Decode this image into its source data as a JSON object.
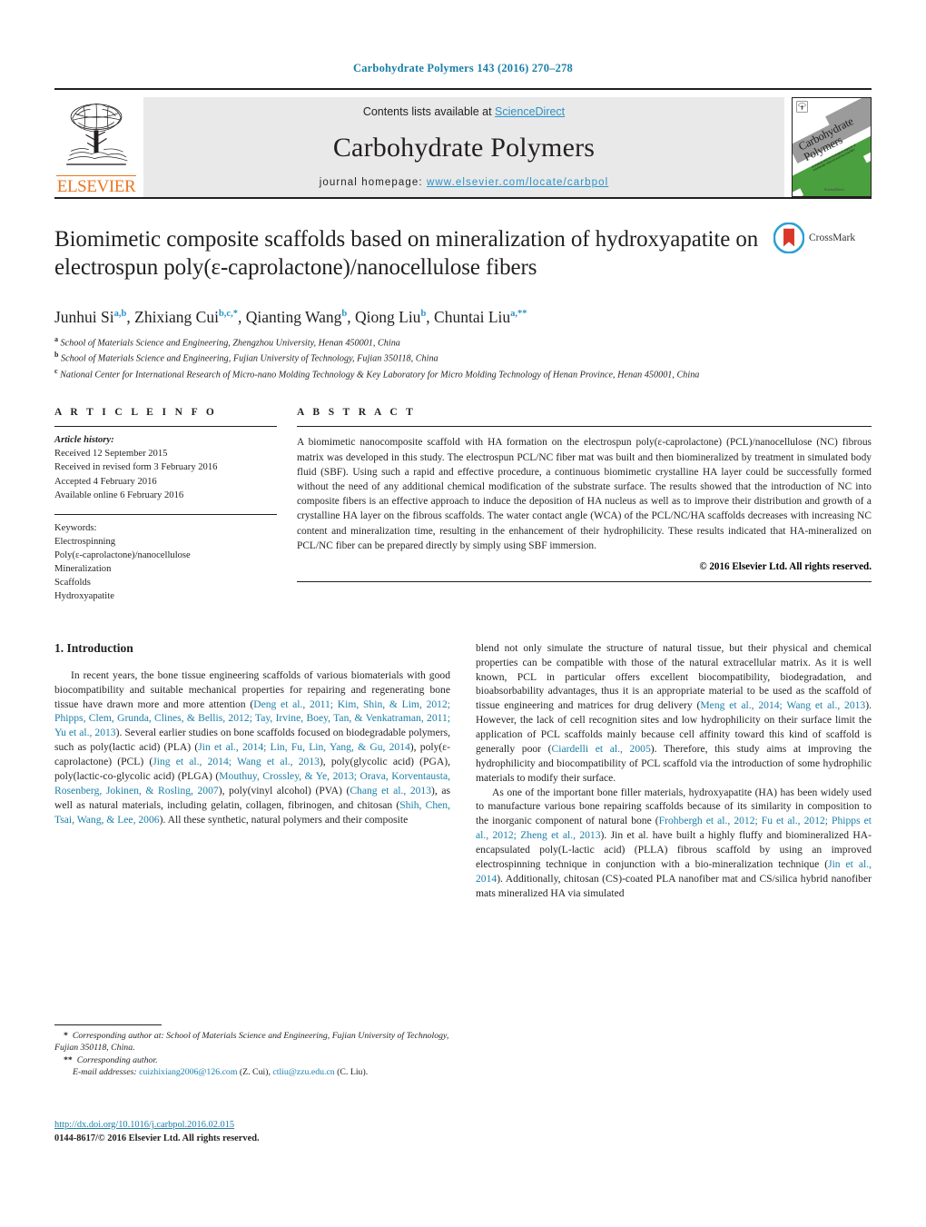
{
  "running_head": "Carbohydrate Polymers 143 (2016) 270–278",
  "masthead": {
    "contents_prefix": "Contents lists available at ",
    "sciencedirect": "ScienceDirect",
    "journal_name": "Carbohydrate Polymers",
    "homepage_prefix": "journal homepage: ",
    "homepage_url": "www.elsevier.com/locate/carbpol",
    "publisher": "ELSEVIER",
    "cover": {
      "title_line1": "Carbohydrate",
      "title_line2": "Polymers",
      "subtitle": "analytical and technological aspects of industrially-relevant polysaccharides",
      "footer": "ScienceDirect"
    }
  },
  "article": {
    "title": "Biomimetic composite scaffolds based on mineralization of hydroxyapatite on electrospun poly(ε-caprolactone)/nanocellulose fibers",
    "crossmark_label": "CrossMark",
    "authors": [
      {
        "name": "Junhui Si",
        "marks": "a,b",
        "sep": ", "
      },
      {
        "name": "Zhixiang Cui",
        "marks": "b,c,*",
        "sep": ", "
      },
      {
        "name": "Qianting Wang",
        "marks": "b",
        "sep": ", "
      },
      {
        "name": "Qiong Liu",
        "marks": "b",
        "sep": ", "
      },
      {
        "name": "Chuntai Liu",
        "marks": "a,**",
        "sep": ""
      }
    ],
    "affiliations": [
      {
        "mark": "a",
        "text": "School of Materials Science and Engineering, Zhengzhou University, Henan 450001, China"
      },
      {
        "mark": "b",
        "text": "School of Materials Science and Engineering, Fujian University of Technology, Fujian 350118, China"
      },
      {
        "mark": "c",
        "text": "National Center for International Research of Micro-nano Molding Technology & Key Laboratory for Micro Molding Technology of Henan Province, Henan 450001, China"
      }
    ]
  },
  "article_info": {
    "heading": "A R T I C L E   I N F O",
    "history_label": "Article history:",
    "history": [
      "Received 12 September 2015",
      "Received in revised form 3 February 2016",
      "Accepted 4 February 2016",
      "Available online 6 February 2016"
    ],
    "keywords_label": "Keywords:",
    "keywords": [
      "Electrospinning",
      "Poly(ε-caprolactone)/nanocellulose",
      "Mineralization",
      "Scaffolds",
      "Hydroxyapatite"
    ]
  },
  "abstract": {
    "heading": "A B S T R A C T",
    "text": "A biomimetic nanocomposite scaffold with HA formation on the electrospun poly(ε-caprolactone) (PCL)/nanocellulose (NC) fibrous matrix was developed in this study. The electrospun PCL/NC fiber mat was built and then biomineralized by treatment in simulated body fluid (SBF). Using such a rapid and effective procedure, a continuous biomimetic crystalline HA layer could be successfully formed without the need of any additional chemical modification of the substrate surface. The results showed that the introduction of NC into composite fibers is an effective approach to induce the deposition of HA nucleus as well as to improve their distribution and growth of a crystalline HA layer on the fibrous scaffolds. The water contact angle (WCA) of the PCL/NC/HA scaffolds decreases with increasing NC content and mineralization time, resulting in the enhancement of their hydrophilicity. These results indicated that HA-mineralized on PCL/NC fiber can be prepared directly by simply using SBF immersion.",
    "copyright": "© 2016 Elsevier Ltd. All rights reserved."
  },
  "intro": {
    "heading": "1.  Introduction",
    "left_paragraph_html": "In recent years, the bone tissue engineering scaffolds of various biomaterials with good biocompatibility and suitable mechanical properties for repairing and regenerating bone tissue have drawn more and more attention (<c>Deng et al., 2011; Kim, Shin, &amp; Lim, 2012; Phipps, Clem, Grunda, Clines, &amp; Bellis, 2012; Tay, Irvine, Boey, Tan, &amp; Venkatraman, 2011; Yu et al., 2013</c>). Several earlier studies on bone scaffolds focused on biodegradable polymers, such as poly(lactic acid) (PLA) (<c>Jin et al., 2014; Lin, Fu, Lin, Yang, &amp; Gu, 2014</c>), poly(ε-caprolactone) (PCL) (<c>Jing et al., 2014; Wang et al., 2013</c>), poly(glycolic acid) (PGA), poly(lactic-co-glycolic acid) (PLGA) (<c>Mouthuy, Crossley, &amp; Ye, 2013; Orava, Korventausta, Rosenberg, Jokinen, &amp; Rosling, 2007</c>), poly(vinyl alcohol) (PVA) (<c>Chang et al., 2013</c>), as well as natural materials, including gelatin, collagen, fibrinogen, and chitosan (<c>Shih, Chen, Tsai, Wang, &amp; Lee, 2006</c>). All these synthetic, natural polymers and their composite",
    "right_paragraph_1_html": "blend not only simulate the structure of natural tissue, but their physical and chemical properties can be compatible with those of the natural extracellular matrix. As it is well known, PCL in particular offers excellent biocompatibility, biodegradation, and bioabsorbability advantages, thus it is an appropriate material to be used as the scaffold of tissue engineering and matrices for drug delivery (<c>Meng et al., 2014; Wang et al., 2013</c>). However, the lack of cell recognition sites and low hydrophilicity on their surface limit the application of PCL scaffolds mainly because cell affinity toward this kind of scaffold is generally poor (<c>Ciardelli et al., 2005</c>). Therefore, this study aims at improving the hydrophilicity and biocompatibility of PCL scaffold via the introduction of some hydrophilic materials to modify their surface.",
    "right_paragraph_2_html": "As one of the important bone filler materials, hydroxyapatite (HA) has been widely used to manufacture various bone repairing scaffolds because of its similarity in composition to the inorganic component of natural bone (<c>Frohbergh et al., 2012; Fu et al., 2012; Phipps et al., 2012; Zheng et al., 2013</c>). Jin et al. have built a highly fluffy and biomineralized HA-encapsulated poly(L-lactic acid) (PLLA) fibrous scaffold by using an improved electrospinning technique in conjunction with a bio-mineralization technique (<c>Jin et al., 2014</c>). Additionally, chitosan (CS)-coated PLA nanofiber mat and CS/silica hybrid nanofiber mats mineralized HA via simulated"
  },
  "footnotes": {
    "corresponding_1_html": "<b>*</b>&nbsp; <i>Corresponding author at: School of Materials Science and Engineering, Fujian University of Technology, Fujian 350118, China.</i>",
    "corresponding_2_html": "<b>**</b>&nbsp; <i>Corresponding author.</i>",
    "emails_label": "E-mail addresses:",
    "email_1": "cuizhixiang2006@126.com",
    "email_1_owner": "(Z. Cui),",
    "email_2": "ctliu@zzu.edu.cn",
    "email_2_owner": "(C. Liu)."
  },
  "doi_block": {
    "doi_url": "http://dx.doi.org/10.1016/j.carbpol.2016.02.015",
    "issn_line": "0144-8617/© 2016 Elsevier Ltd. All rights reserved."
  },
  "colors": {
    "link_blue": "#1a7fa8",
    "sciencedirect_blue": "#2b93c9",
    "elsevier_orange": "#e87722",
    "band_grey": "#e9e9e9",
    "cover_green": "#4aa03f"
  }
}
